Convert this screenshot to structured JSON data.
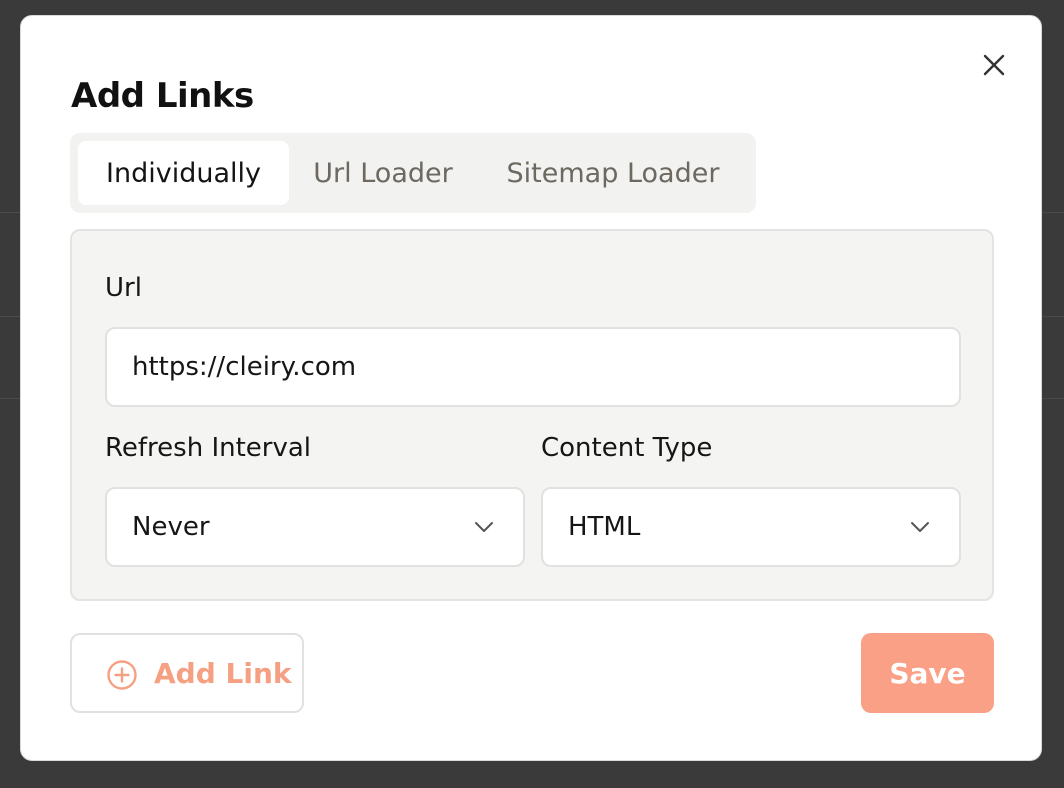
{
  "modal": {
    "title": "Add Links",
    "close_icon": "close-icon"
  },
  "tabs": [
    {
      "label": "Individually",
      "active": true
    },
    {
      "label": "Url Loader",
      "active": false
    },
    {
      "label": "Sitemap Loader",
      "active": false
    }
  ],
  "form": {
    "url_label": "Url",
    "url_value": "https://cleiry.com",
    "refresh_label": "Refresh Interval",
    "refresh_value": "Never",
    "content_label": "Content Type",
    "content_value": "HTML"
  },
  "actions": {
    "add_link_label": "Add Link",
    "add_link_icon": "plus-circle-icon",
    "save_label": "Save"
  },
  "colors": {
    "accent": "#f9a086",
    "accent_text": "#f6a083",
    "backdrop": "#3a3a3a"
  }
}
